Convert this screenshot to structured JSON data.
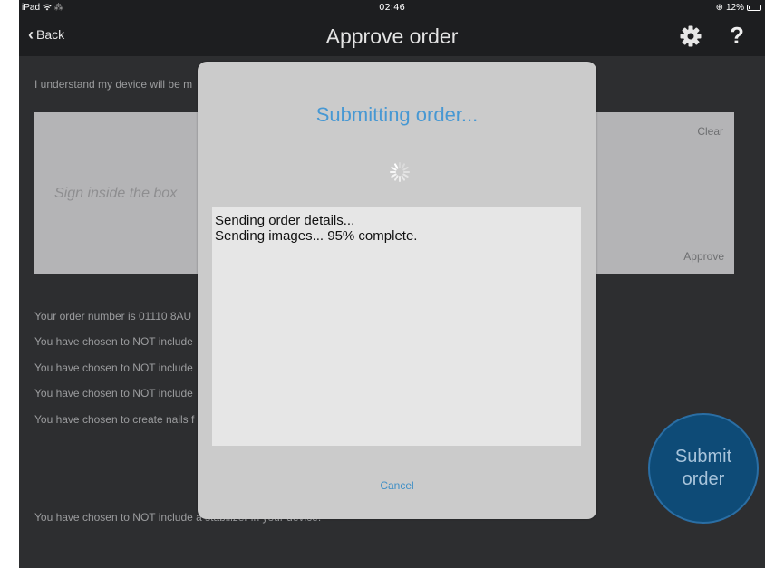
{
  "status_bar": {
    "device": "iPad",
    "time": "02:46",
    "battery": "12%",
    "battery_level": 0.12
  },
  "nav": {
    "back_label": "Back",
    "title": "Approve order"
  },
  "background": {
    "disclaimer": "I understand my device will be m",
    "signature": {
      "placeholder": "Sign inside the box",
      "clear_label": "Clear",
      "approve_label": "Approve"
    },
    "lines": [
      "Your order number is 01110 8AU",
      "You have chosen to NOT include",
      "You have chosen to NOT include",
      "You have chosen to NOT include",
      "You have chosen to create nails f"
    ],
    "bottom_line": "You have chosen to NOT include a stabilizer in your device.",
    "submit": {
      "line1": "Submit",
      "line2": "order"
    }
  },
  "dialog": {
    "title": "Submitting order...",
    "log": [
      "Sending order details...",
      "Sending images... 95% complete."
    ],
    "progress_percent": 95,
    "cancel_label": "Cancel"
  },
  "icons": {
    "wifi": "wifi-icon",
    "activity": "activity-spinner-icon",
    "gear": "gear-icon",
    "help": "help-icon",
    "back": "chevron-left-icon"
  },
  "colors": {
    "accent": "#4798d3",
    "submit_circle": "#0e4b77",
    "background": "#2d2e30",
    "navbar": "#1d1e20"
  }
}
